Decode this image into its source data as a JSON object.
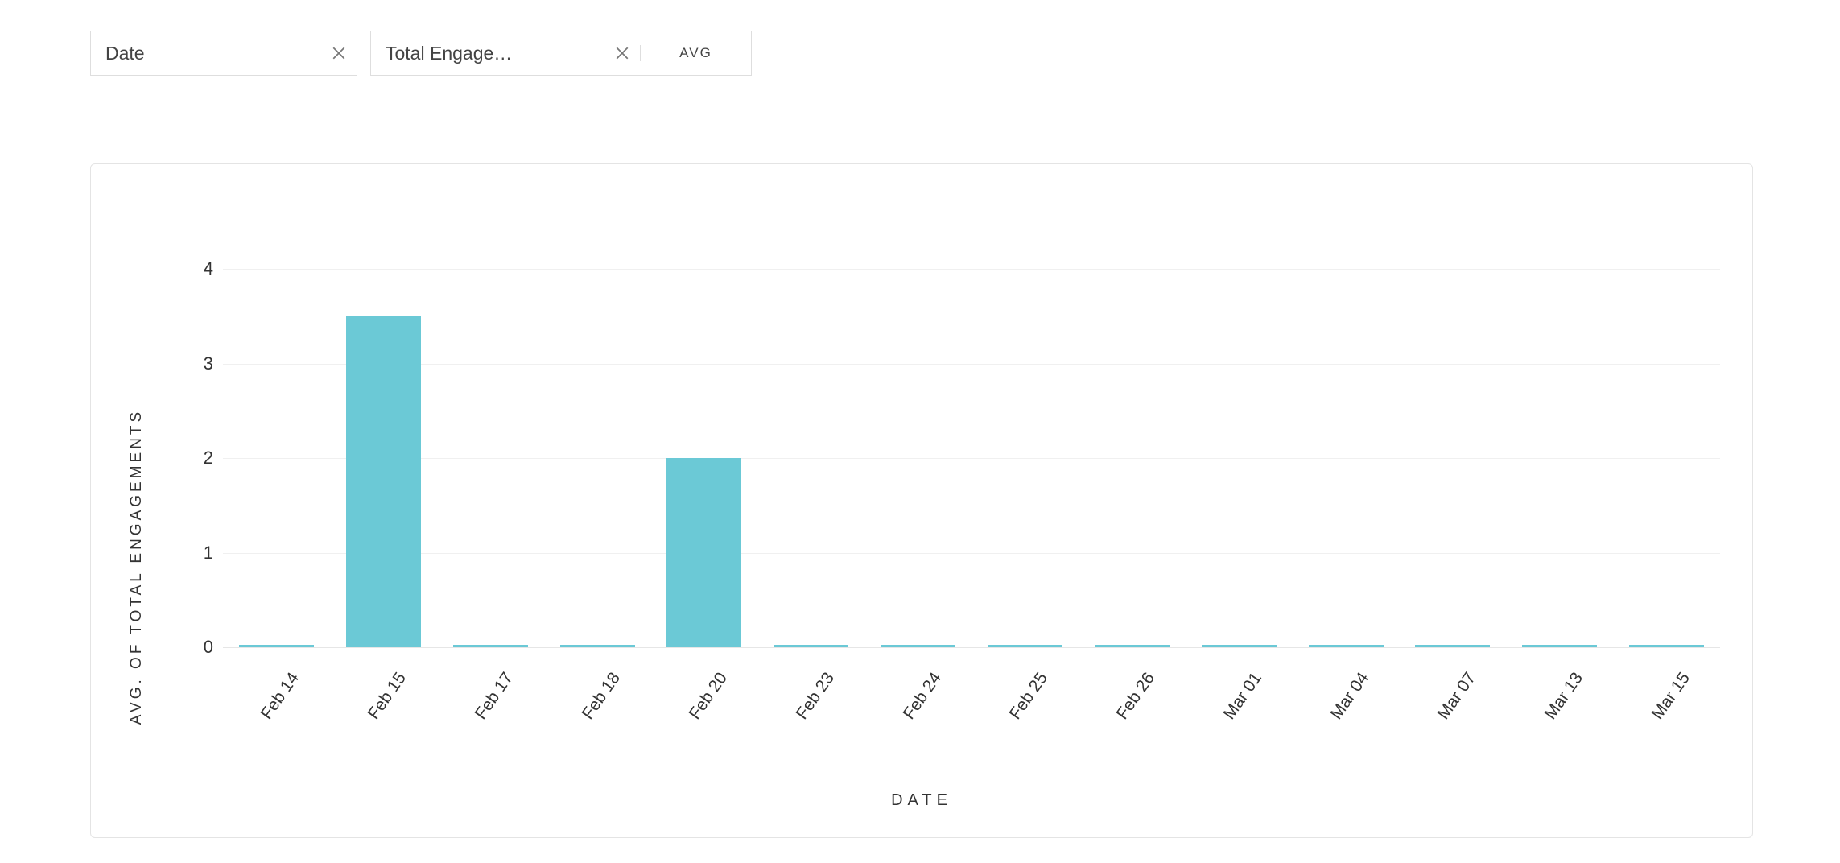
{
  "pills": {
    "date": {
      "label": "Date"
    },
    "metric": {
      "label": "Total Engage…",
      "agg": "AVG"
    }
  },
  "chart_data": {
    "type": "bar",
    "categories": [
      "Feb 14",
      "Feb 15",
      "Feb 17",
      "Feb 18",
      "Feb 20",
      "Feb 23",
      "Feb 24",
      "Feb 25",
      "Feb 26",
      "Mar 01",
      "Mar 04",
      "Mar 07",
      "Mar 13",
      "Mar 15"
    ],
    "values": [
      0,
      3.5,
      0,
      0,
      2,
      0,
      0,
      0,
      0,
      0,
      0,
      0,
      0,
      0
    ],
    "y_ticks": [
      0,
      1,
      2,
      3,
      4
    ],
    "ylim": [
      0,
      4
    ],
    "ylabel": "AVG. OF TOTAL ENGAGEMENTS",
    "xlabel": "DATE",
    "bar_color": "#6bc9d6"
  }
}
